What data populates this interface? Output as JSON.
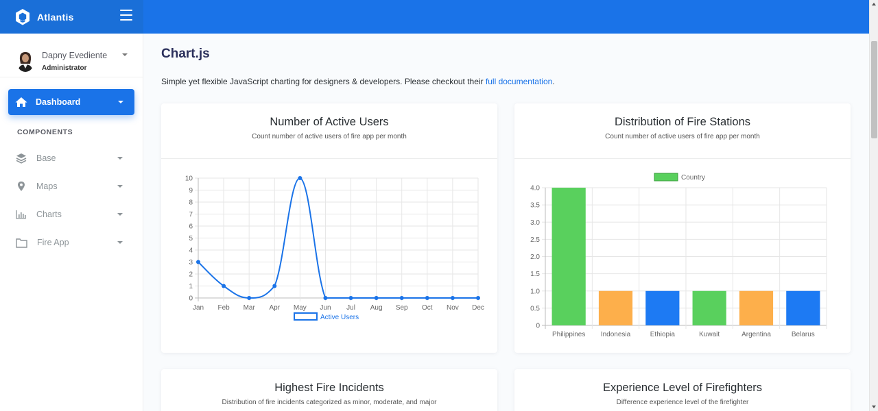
{
  "app": {
    "name": "Atlantis"
  },
  "user": {
    "name": "Dapny Evediente",
    "role": "Administrator"
  },
  "sidebar": {
    "active": {
      "label": "Dashboard"
    },
    "section_label": "COMPONENTS",
    "items": [
      {
        "label": "Base",
        "icon": "layers-icon"
      },
      {
        "label": "Maps",
        "icon": "map-marker-icon"
      },
      {
        "label": "Charts",
        "icon": "bar-chart-icon"
      },
      {
        "label": "Fire App",
        "icon": "folder-icon"
      }
    ]
  },
  "page": {
    "title": "Chart.js",
    "description": "Simple yet flexible JavaScript charting for designers & developers. Please checkout their ",
    "link_text": "full documentation",
    "period": "."
  },
  "colors": {
    "brand": "#1a73e8",
    "green": "#59d05d",
    "orange": "#fdaf4b",
    "blue": "#1d7af3"
  },
  "cards": [
    {
      "title": "Number of Active Users",
      "subtitle": "Count number of active users of fire app per month"
    },
    {
      "title": "Distribution of Fire Stations",
      "subtitle": "Count number of active users of fire app per month"
    },
    {
      "title": "Highest Fire Incidents",
      "subtitle": "Distribution of fire incidents categorized as minor, moderate, and major"
    },
    {
      "title": "Experience Level of Firefighters",
      "subtitle": "Difference experience level of the firefighter"
    }
  ],
  "chart_data": [
    {
      "type": "line",
      "title": "",
      "categories": [
        "Jan",
        "Feb",
        "Mar",
        "Apr",
        "May",
        "Jun",
        "Jul",
        "Aug",
        "Sep",
        "Oct",
        "Nov",
        "Dec"
      ],
      "series": [
        {
          "name": "Active Users",
          "values": [
            3,
            1,
            0,
            1,
            10,
            0,
            0,
            0,
            0,
            0,
            0,
            0
          ]
        }
      ],
      "ylim": [
        0,
        10
      ],
      "yticks": [
        "0",
        "1",
        "2",
        "3",
        "4",
        "5",
        "6",
        "7",
        "8",
        "9",
        "10"
      ],
      "grid": true,
      "legend": "bottom"
    },
    {
      "type": "bar",
      "title": "",
      "categories": [
        "Philippines",
        "Indonesia",
        "Ethiopia",
        "Kuwait",
        "Argentina",
        "Belarus"
      ],
      "series": [
        {
          "name": "Country",
          "values": [
            4,
            1,
            1,
            1,
            1,
            1
          ]
        }
      ],
      "bar_colors": [
        "#59d05d",
        "#fdaf4b",
        "#1d7af3",
        "#59d05d",
        "#fdaf4b",
        "#1d7af3"
      ],
      "ylim": [
        0,
        4
      ],
      "yticks": [
        "0",
        "0.5",
        "1.0",
        "1.5",
        "2.0",
        "2.5",
        "3.0",
        "3.5",
        "4.0"
      ],
      "grid": true,
      "legend": "top"
    }
  ]
}
